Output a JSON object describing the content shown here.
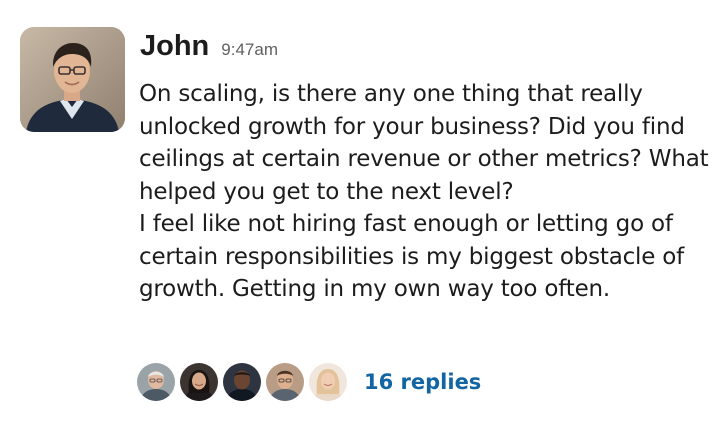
{
  "message": {
    "author": "John",
    "timestamp": "9:47am",
    "body_paragraphs": [
      "On scaling, is there any one thing that really unlocked growth for your business? Did you find ceilings at certain revenue or other metrics? What helped you get to the next level?",
      "I feel like not hiring fast enough or letting go of certain responsibilities is my biggest obstacle of growth. Getting in my own way too often."
    ],
    "avatar_icon": "user-photo"
  },
  "thread": {
    "participant_avatar_icons": [
      "participant-avatar-1",
      "participant-avatar-2",
      "participant-avatar-3",
      "participant-avatar-4",
      "participant-avatar-5"
    ],
    "replies_label": "16 replies"
  },
  "colors": {
    "text": "#1d1c1d",
    "timestamp": "#616061",
    "link": "#1264a3",
    "background": "#ffffff"
  }
}
